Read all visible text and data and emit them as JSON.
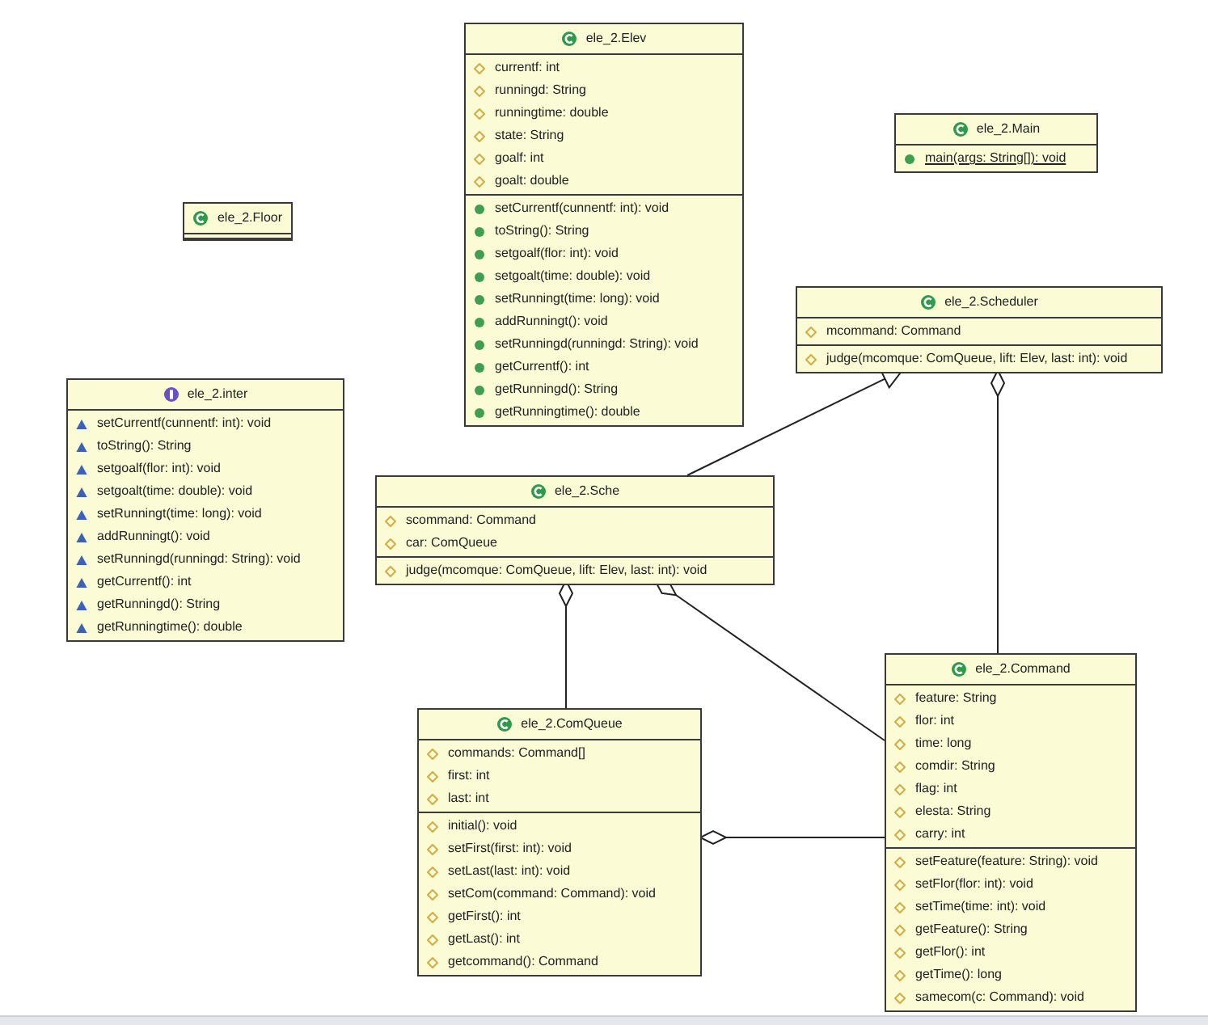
{
  "classes": [
    {
      "name": "ele_2.Elev",
      "kind": "class",
      "fields": [
        {
          "text": "currentf: int",
          "kind": "package"
        },
        {
          "text": "runningd: String",
          "kind": "package"
        },
        {
          "text": "runningtime: double",
          "kind": "package"
        },
        {
          "text": "state: String",
          "kind": "package"
        },
        {
          "text": "goalf: int",
          "kind": "package"
        },
        {
          "text": "goalt: double",
          "kind": "package"
        }
      ],
      "methods": [
        {
          "text": "setCurrentf(cunnentf: int): void",
          "kind": "public"
        },
        {
          "text": "toString(): String",
          "kind": "public"
        },
        {
          "text": "setgoalf(flor: int): void",
          "kind": "public"
        },
        {
          "text": "setgoalt(time: double): void",
          "kind": "public"
        },
        {
          "text": "setRunningt(time: long): void",
          "kind": "public"
        },
        {
          "text": "addRunningt(): void",
          "kind": "public"
        },
        {
          "text": "setRunningd(runningd: String): void",
          "kind": "public"
        },
        {
          "text": "getCurrentf(): int",
          "kind": "public"
        },
        {
          "text": "getRunningd(): String",
          "kind": "public"
        },
        {
          "text": "getRunningtime(): double",
          "kind": "public"
        }
      ]
    },
    {
      "name": "ele_2.Main",
      "kind": "class",
      "methods": [
        {
          "text": "main(args: String[]): void",
          "kind": "public_static"
        }
      ]
    },
    {
      "name": "ele_2.Floor",
      "kind": "class"
    },
    {
      "name": "ele_2.Scheduler",
      "kind": "class",
      "fields": [
        {
          "text": "mcommand: Command",
          "kind": "package"
        }
      ],
      "methods": [
        {
          "text": "judge(mcomque: ComQueue, lift: Elev, last: int): void",
          "kind": "package"
        }
      ]
    },
    {
      "name": "ele_2.inter",
      "kind": "interface",
      "methods": [
        {
          "text": "setCurrentf(cunnentf: int): void",
          "kind": "abstract"
        },
        {
          "text": "toString(): String",
          "kind": "abstract"
        },
        {
          "text": "setgoalf(flor: int): void",
          "kind": "abstract"
        },
        {
          "text": "setgoalt(time: double): void",
          "kind": "abstract"
        },
        {
          "text": "setRunningt(time: long): void",
          "kind": "abstract"
        },
        {
          "text": "addRunningt(): void",
          "kind": "abstract"
        },
        {
          "text": "setRunningd(runningd: String): void",
          "kind": "abstract"
        },
        {
          "text": "getCurrentf(): int",
          "kind": "abstract"
        },
        {
          "text": "getRunningd(): String",
          "kind": "abstract"
        },
        {
          "text": "getRunningtime(): double",
          "kind": "abstract"
        }
      ]
    },
    {
      "name": "ele_2.Sche",
      "kind": "class",
      "fields": [
        {
          "text": "scommand: Command",
          "kind": "package"
        },
        {
          "text": "car: ComQueue",
          "kind": "package"
        }
      ],
      "methods": [
        {
          "text": "judge(mcomque: ComQueue, lift: Elev, last: int): void",
          "kind": "package"
        }
      ]
    },
    {
      "name": "ele_2.Command",
      "kind": "class",
      "fields": [
        {
          "text": "feature: String",
          "kind": "package"
        },
        {
          "text": "flor: int",
          "kind": "package"
        },
        {
          "text": "time: long",
          "kind": "package"
        },
        {
          "text": "comdir: String",
          "kind": "package"
        },
        {
          "text": "flag: int",
          "kind": "package"
        },
        {
          "text": "elesta: String",
          "kind": "package"
        },
        {
          "text": "carry: int",
          "kind": "package"
        }
      ],
      "methods": [
        {
          "text": "setFeature(feature: String): void",
          "kind": "package"
        },
        {
          "text": "setFlor(flor: int): void",
          "kind": "package"
        },
        {
          "text": "setTime(time: int): void",
          "kind": "package"
        },
        {
          "text": "getFeature(): String",
          "kind": "package"
        },
        {
          "text": "getFlor(): int",
          "kind": "package"
        },
        {
          "text": "getTime(): long",
          "kind": "package"
        },
        {
          "text": "samecom(c: Command): void",
          "kind": "package"
        }
      ]
    },
    {
      "name": "ele_2.ComQueue",
      "kind": "class",
      "fields": [
        {
          "text": "commands: Command[]",
          "kind": "package"
        },
        {
          "text": "first: int",
          "kind": "package"
        },
        {
          "text": "last: int",
          "kind": "package"
        }
      ],
      "methods": [
        {
          "text": "initial(): void",
          "kind": "package"
        },
        {
          "text": "setFirst(first: int): void",
          "kind": "package"
        },
        {
          "text": "setLast(last: int): void",
          "kind": "package"
        },
        {
          "text": "setCom(command: Command): void",
          "kind": "package"
        },
        {
          "text": "getFirst(): int",
          "kind": "package"
        },
        {
          "text": "getLast(): int",
          "kind": "package"
        },
        {
          "text": "getcommand(): Command",
          "kind": "package"
        }
      ]
    }
  ],
  "relations": [
    {
      "kind": "generalization"
    },
    {
      "kind": "composition"
    },
    {
      "kind": "composition"
    },
    {
      "kind": "composition"
    },
    {
      "kind": "composition"
    }
  ]
}
